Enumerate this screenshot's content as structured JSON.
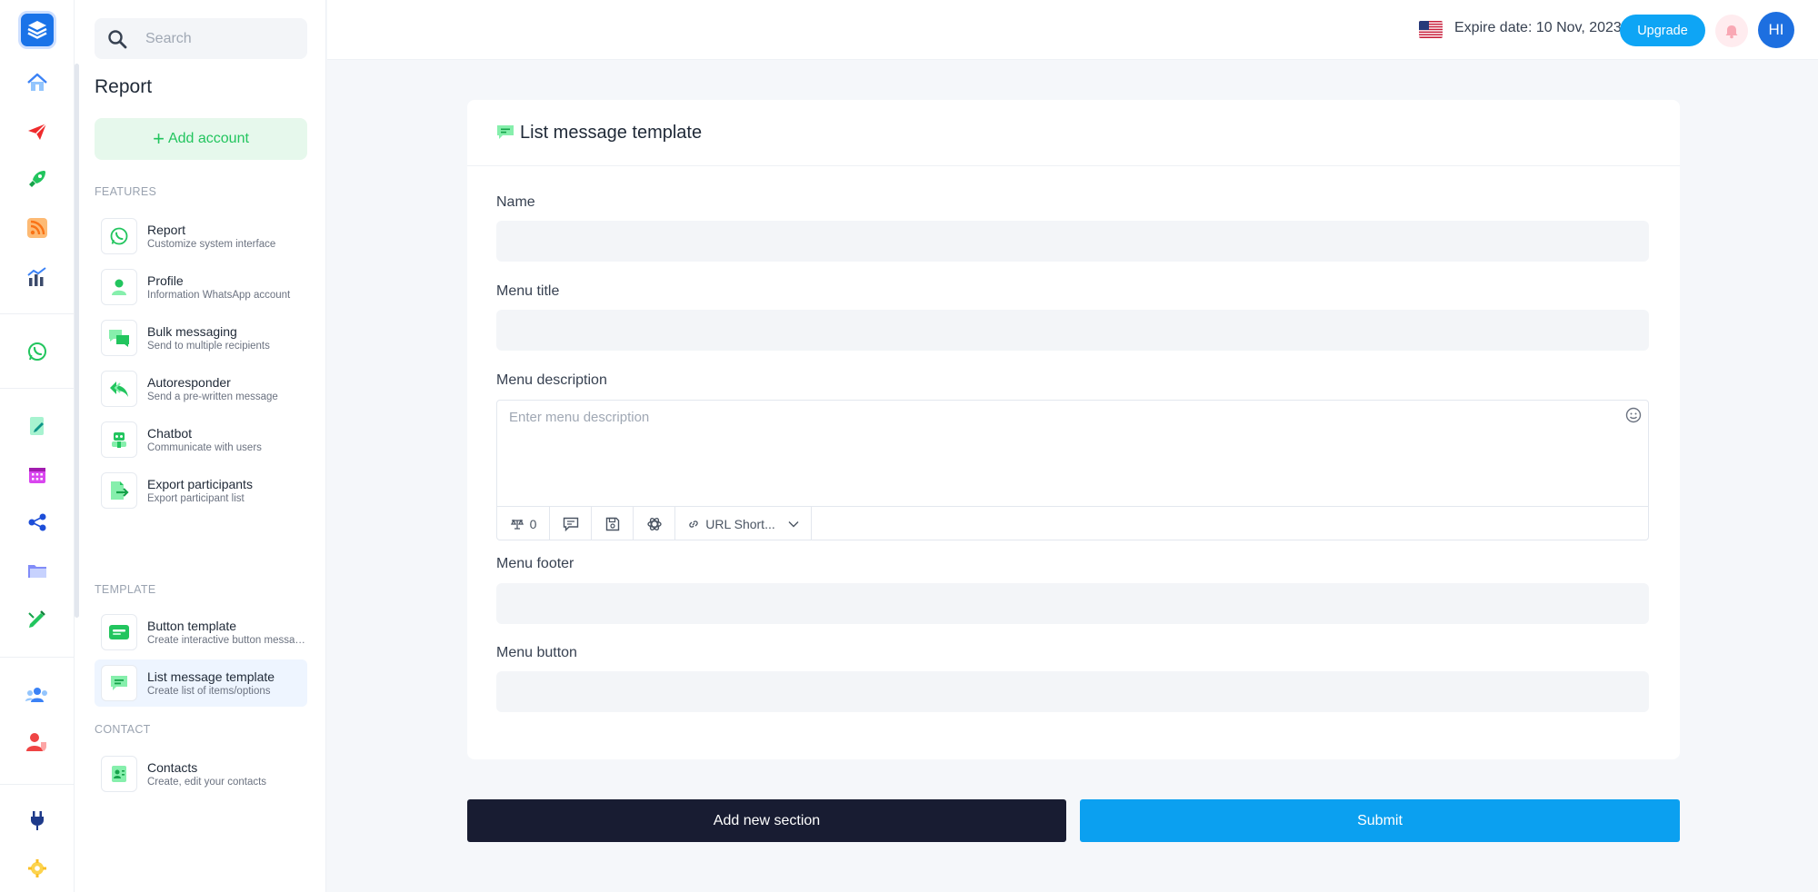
{
  "header": {
    "expire_text": "Expire date: 10 Nov, 2023",
    "upgrade_label": "Upgrade",
    "avatar_initials": "HI"
  },
  "sidebar": {
    "search_placeholder": "Search",
    "title": "Report",
    "add_account_label": "Add account",
    "features_label": "FEATURES",
    "features": [
      {
        "title": "Report",
        "subtitle": "Customize system interface",
        "icon": "whatsapp-icon"
      },
      {
        "title": "Profile",
        "subtitle": "Information WhatsApp account",
        "icon": "user-icon"
      },
      {
        "title": "Bulk messaging",
        "subtitle": "Send to multiple recipients",
        "icon": "chat-bubbles-icon"
      },
      {
        "title": "Autoresponder",
        "subtitle": "Send a pre-written message",
        "icon": "reply-icon"
      },
      {
        "title": "Chatbot",
        "subtitle": "Communicate with users",
        "icon": "robot-icon"
      },
      {
        "title": "Export participants",
        "subtitle": "Export participant list",
        "icon": "file-export-icon"
      }
    ],
    "template_label": "TEMPLATE",
    "templates": [
      {
        "title": "Button template",
        "subtitle": "Create interactive button messages",
        "icon": "button-template-icon"
      },
      {
        "title": "List message template",
        "subtitle": "Create list of items/options",
        "icon": "list-message-icon"
      }
    ],
    "contact_label": "CONTACT",
    "contacts": [
      {
        "title": "Contacts",
        "subtitle": "Create, edit your contacts",
        "icon": "contacts-icon"
      }
    ]
  },
  "form": {
    "title": "List message template",
    "name_label": "Name",
    "name_value": "",
    "menu_title_label": "Menu title",
    "menu_title_value": "",
    "menu_description_label": "Menu description",
    "menu_description_placeholder": "Enter menu description",
    "toolbar": {
      "spintax_count": "0",
      "url_shortener_label": "URL Short..."
    },
    "menu_footer_label": "Menu footer",
    "menu_footer_value": "",
    "menu_button_label": "Menu button",
    "menu_button_value": "",
    "add_section_label": "Add new section",
    "submit_label": "Submit"
  },
  "colors": {
    "primary": "#0ba0f0",
    "dark_button": "#181c32",
    "green_accent": "#22c55e",
    "logo_blue": "#1a73e8"
  }
}
